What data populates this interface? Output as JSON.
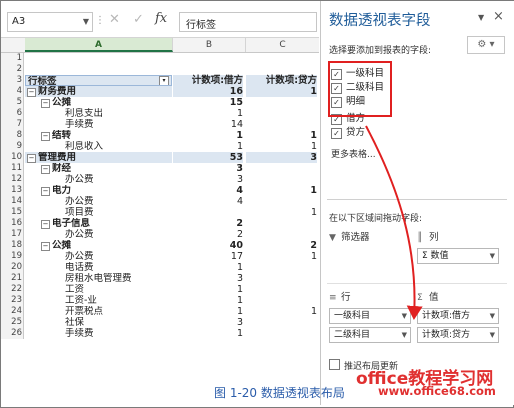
{
  "formula_bar": {
    "name_box": "A3",
    "cancel_glyph": "✕",
    "enter_glyph": "✓",
    "fx_label": "fx",
    "content": "行标签"
  },
  "columns": [
    "A",
    "B",
    "C"
  ],
  "rows": [
    {
      "n": "1",
      "a": "",
      "b": "",
      "c": "",
      "level": 0
    },
    {
      "n": "2",
      "a": "",
      "b": "",
      "c": "",
      "level": 0
    },
    {
      "n": "3",
      "a": "行标签",
      "b": "计数项:借方",
      "c": "计数项:贷方",
      "level": 0,
      "header": true
    },
    {
      "n": "4",
      "a": "财务费用",
      "b": "16",
      "c": "1",
      "level": 0,
      "toggle": "⊟",
      "bold": true,
      "selected": true
    },
    {
      "n": "5",
      "a": "公摊",
      "b": "15",
      "c": "",
      "level": 1,
      "toggle": "⊟",
      "bold": true
    },
    {
      "n": "6",
      "a": "利息支出",
      "b": "1",
      "c": "",
      "level": 2
    },
    {
      "n": "7",
      "a": "手续费",
      "b": "14",
      "c": "",
      "level": 2
    },
    {
      "n": "8",
      "a": "结转",
      "b": "1",
      "c": "1",
      "level": 1,
      "toggle": "⊟",
      "bold": true
    },
    {
      "n": "9",
      "a": "利息收入",
      "b": "1",
      "c": "1",
      "level": 2
    },
    {
      "n": "10",
      "a": "管理费用",
      "b": "53",
      "c": "3",
      "level": 0,
      "toggle": "⊟",
      "bold": true,
      "selected": true
    },
    {
      "n": "11",
      "a": "财经",
      "b": "3",
      "c": "",
      "level": 1,
      "toggle": "⊟",
      "bold": true
    },
    {
      "n": "12",
      "a": "办公费",
      "b": "3",
      "c": "",
      "level": 2
    },
    {
      "n": "13",
      "a": "电力",
      "b": "4",
      "c": "1",
      "level": 1,
      "toggle": "⊟",
      "bold": true
    },
    {
      "n": "14",
      "a": "办公费",
      "b": "4",
      "c": "",
      "level": 2
    },
    {
      "n": "15",
      "a": "项目费",
      "b": "",
      "c": "1",
      "level": 2
    },
    {
      "n": "16",
      "a": "电子信息",
      "b": "2",
      "c": "",
      "level": 1,
      "toggle": "⊟",
      "bold": true
    },
    {
      "n": "17",
      "a": "办公费",
      "b": "2",
      "c": "",
      "level": 2
    },
    {
      "n": "18",
      "a": "公摊",
      "b": "40",
      "c": "2",
      "level": 1,
      "toggle": "⊟",
      "bold": true
    },
    {
      "n": "19",
      "a": "办公费",
      "b": "17",
      "c": "1",
      "level": 2
    },
    {
      "n": "20",
      "a": "电话费",
      "b": "1",
      "c": "",
      "level": 2
    },
    {
      "n": "21",
      "a": "房租水电管理费",
      "b": "3",
      "c": "",
      "level": 2
    },
    {
      "n": "22",
      "a": "工资",
      "b": "1",
      "c": "",
      "level": 2
    },
    {
      "n": "23",
      "a": "工资-业",
      "b": "1",
      "c": "",
      "level": 2
    },
    {
      "n": "24",
      "a": "开票税点",
      "b": "1",
      "c": "1",
      "level": 2
    },
    {
      "n": "25",
      "a": "社保",
      "b": "3",
      "c": "",
      "level": 2
    },
    {
      "n": "26",
      "a": "手续费",
      "b": "1",
      "c": "",
      "level": 2
    }
  ],
  "panel": {
    "title": "数据透视表字段",
    "close_glyph": "×",
    "dropdown_glyph": "▼",
    "subtitle": "选择要添加到报表的字段:",
    "settings_glyph": "⚙ ▾",
    "fields": [
      {
        "label": "一级科目",
        "checked": true
      },
      {
        "label": "二级科目",
        "checked": true
      },
      {
        "label": "明细",
        "checked": true
      },
      {
        "label": "借方",
        "checked": true
      },
      {
        "label": "贷方",
        "checked": true
      }
    ],
    "more_tables": "更多表格...",
    "areas_label": "在以下区域间拖动字段:",
    "filters_label": "筛选器",
    "columns_label": "列",
    "columns_items": [
      "Σ 数值"
    ],
    "rows_label": "行",
    "rows_items": [
      "一级科目",
      "二级科目"
    ],
    "values_label": "值",
    "values_items": [
      "计数项:借方",
      "计数项:贷方"
    ],
    "defer_label": "推迟布局更新"
  },
  "caption": "图 1-20  数据透视表布局",
  "watermark_main": "office教程学习网",
  "watermark_url": "www.office68.com"
}
